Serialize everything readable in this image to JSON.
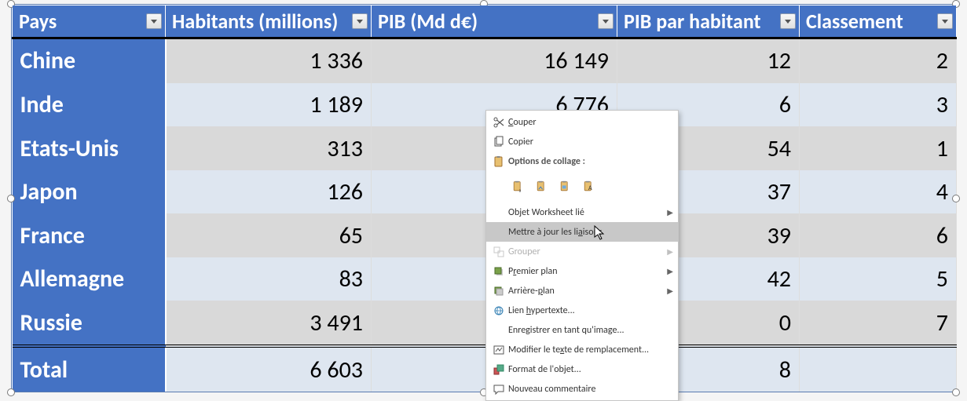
{
  "table": {
    "headers": [
      "Pays",
      "Habitants (millions)",
      "PIB (Md d€)",
      "PIB par habitant",
      "Classement"
    ],
    "rows": [
      {
        "country": "Chine",
        "pop": "1 336",
        "pib": "16 149",
        "pib_hab": "12",
        "rank": "2"
      },
      {
        "country": "Inde",
        "pop": "1 189",
        "pib": "6 776",
        "pib_hab": "6",
        "rank": "3"
      },
      {
        "country": "Etats-Unis",
        "pop": "313",
        "pib": "",
        "pib_hab": "54",
        "rank": "1"
      },
      {
        "country": "Japon",
        "pop": "126",
        "pib": "",
        "pib_hab": "37",
        "rank": "4"
      },
      {
        "country": "France",
        "pop": "65",
        "pib": "",
        "pib_hab": "39",
        "rank": "6"
      },
      {
        "country": "Allemagne",
        "pop": "83",
        "pib": "",
        "pib_hab": "42",
        "rank": "5"
      },
      {
        "country": "Russie",
        "pop": "3 491",
        "pib": "",
        "pib_hab": "0",
        "rank": "7"
      }
    ],
    "total": {
      "label": "Total",
      "pop": "6 603",
      "pib": "",
      "pib_hab": "8",
      "rank": ""
    }
  },
  "context_menu": {
    "cut": "Couper",
    "copy": "Copier",
    "paste_options": "Options de collage :",
    "linked_object": "Objet Worksheet lié",
    "update_links": "Mettre à jour les liaisons",
    "group": "Grouper",
    "bring_front": "Premier plan",
    "send_back": "Arrière-plan",
    "hyperlink": "Lien hypertexte...",
    "save_as_image": "Enregistrer en tant qu'image...",
    "alt_text": "Modifier le texte de remplacement...",
    "format_object": "Format de l'objet...",
    "new_comment": "Nouveau commentaire"
  },
  "colors": {
    "header_bg": "#4472C4",
    "stripe_a": "#D9D9D9",
    "stripe_b": "#DEE6F0"
  }
}
